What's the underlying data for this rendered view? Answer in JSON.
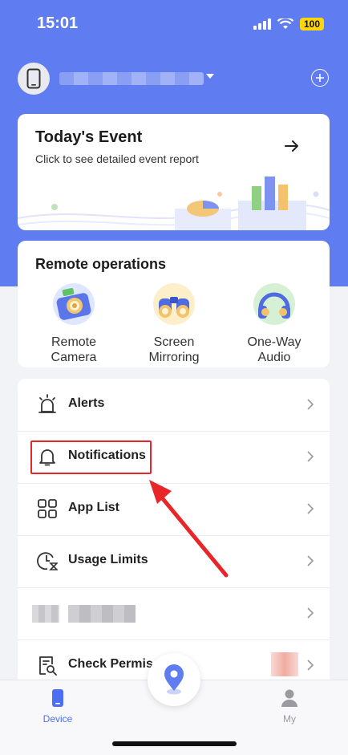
{
  "status_bar": {
    "time": "15:01",
    "battery": "100"
  },
  "colors": {
    "brand": "#5f7cf0",
    "tab_active": "#4c6ef5",
    "tab_inactive": "#9a9aa0",
    "highlight": "#e8262a"
  },
  "event_card": {
    "title": "Today's Event",
    "subtitle": "Click to see detailed event report"
  },
  "remote_operations": {
    "title": "Remote operations",
    "items": [
      {
        "label": "Remote\nCamera",
        "icon": "camera-icon"
      },
      {
        "label": "Screen\nMirroring",
        "icon": "binoculars-icon"
      },
      {
        "label": "One-Way\nAudio",
        "icon": "headphones-icon"
      }
    ]
  },
  "menu": {
    "items": [
      {
        "label": "Alerts",
        "icon": "alarm-icon"
      },
      {
        "label": "Notifications",
        "icon": "bell-icon"
      },
      {
        "label": "App List",
        "icon": "app-grid-icon"
      },
      {
        "label": "Usage Limits",
        "icon": "clock-hourglass-icon"
      },
      {
        "label": "",
        "icon": "pixelated-icon"
      },
      {
        "label": "Check Permis",
        "icon": "document-search-icon"
      }
    ]
  },
  "tab_bar": {
    "tabs": [
      {
        "label": "Device",
        "icon": "phone-icon",
        "active": true
      },
      {
        "label": "My",
        "icon": "person-icon",
        "active": false
      }
    ],
    "center_icon": "location-pin-icon"
  }
}
